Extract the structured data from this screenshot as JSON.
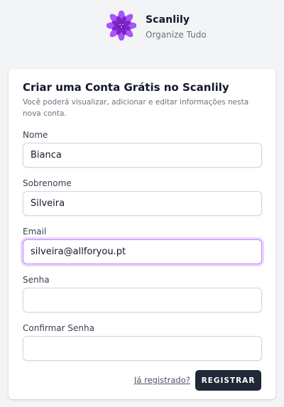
{
  "brand": {
    "name": "Scanlily",
    "tagline": "Organize Tudo",
    "logo_icon": "lotus-flower-icon",
    "logo_color": "#9333ea"
  },
  "form": {
    "title": "Criar uma Conta Grátis no Scanlily",
    "description": "Você poderá visualizar, adicionar e editar informações nesta nova conta.",
    "fields": {
      "first_name": {
        "label": "Nome",
        "value": "Bianca"
      },
      "last_name": {
        "label": "Sobrenome",
        "value": "Silveira"
      },
      "email": {
        "label": "Email",
        "value": "silveira@allforyou.pt"
      },
      "password": {
        "label": "Senha",
        "value": ""
      },
      "confirm_password": {
        "label": "Confirmar Senha",
        "value": ""
      }
    },
    "login_link": "Já registrado?",
    "submit_label": "REGISTRAR"
  },
  "colors": {
    "background": "#f3f4f6",
    "focus_ring": "#d8b4fe",
    "button": "#1f2937"
  }
}
